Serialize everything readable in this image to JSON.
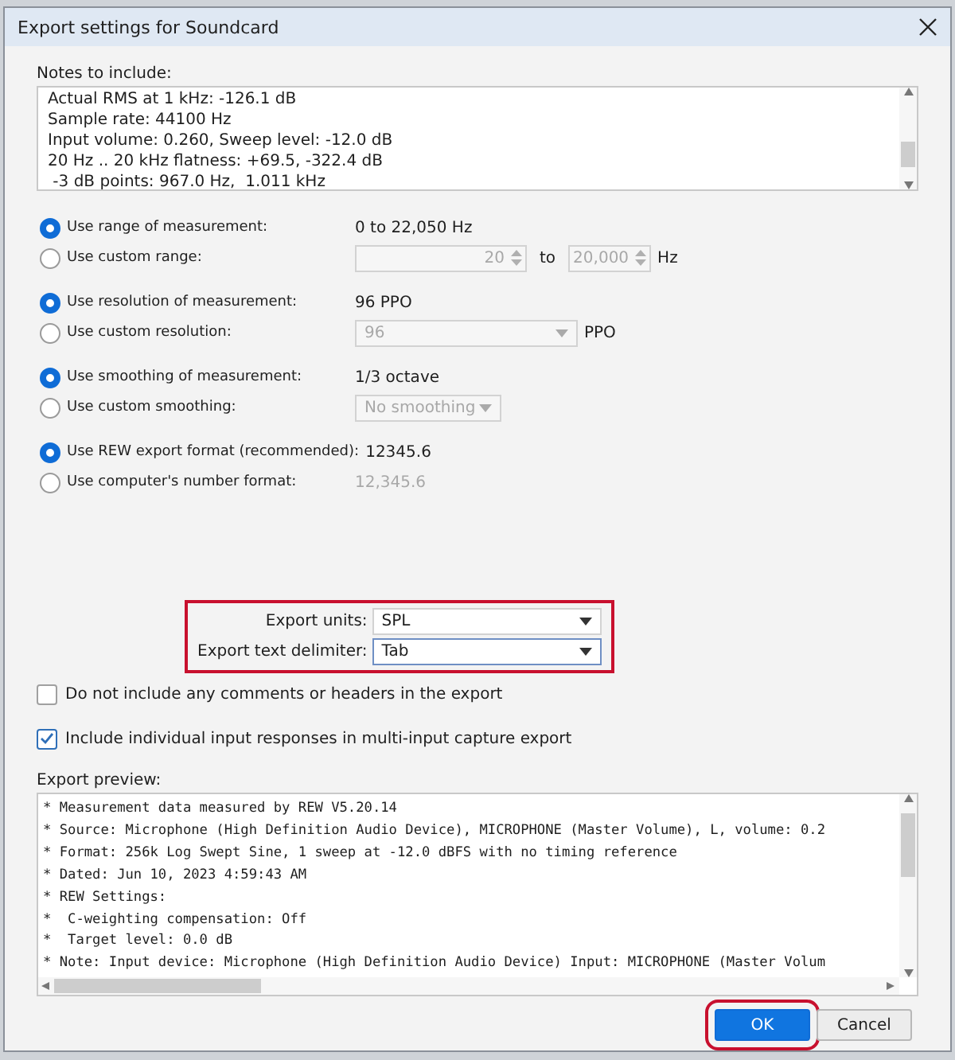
{
  "window": {
    "title": "Export settings for Soundcard"
  },
  "notes": {
    "label": "Notes to include:",
    "lines": [
      "Actual RMS at 1 kHz: -126.1 dB",
      "Sample rate: 44100 Hz",
      "Input volume: 0.260, Sweep level: -12.0 dB",
      "20 Hz .. 20 kHz flatness: +69.5, -322.4 dB",
      " -3 dB points: 967.0 Hz,  1.011 kHz"
    ]
  },
  "option_groups": [
    {
      "options": [
        {
          "label": "Use range of measurement:",
          "selected": true,
          "kind": "text",
          "value": "0 to 22,050 Hz"
        },
        {
          "label": "Use custom range:",
          "selected": false,
          "kind": "range",
          "from": "20",
          "to_label": "to",
          "to": "20,000",
          "unit": "Hz"
        }
      ]
    },
    {
      "options": [
        {
          "label": "Use resolution of measurement:",
          "selected": true,
          "kind": "text",
          "value": "96 PPO"
        },
        {
          "label": "Use custom resolution:",
          "selected": false,
          "kind": "select",
          "value": "96",
          "unit": "PPO"
        }
      ]
    },
    {
      "options": [
        {
          "label": "Use smoothing of measurement:",
          "selected": true,
          "kind": "text",
          "value": "1/3 octave"
        },
        {
          "label": "Use custom smoothing:",
          "selected": false,
          "kind": "small-select",
          "value": "No smoothing"
        }
      ]
    },
    {
      "options": [
        {
          "label": "Use REW export format (recommended):",
          "selected": true,
          "kind": "text",
          "value": "12345.6"
        },
        {
          "label": "Use computer's number format:",
          "selected": false,
          "kind": "text",
          "value": "12,345.6"
        }
      ]
    }
  ],
  "export_fields": {
    "highlighted": true,
    "fields": [
      {
        "label": "Export units:",
        "value": "SPL",
        "focused": false
      },
      {
        "label": "Export text delimiter:",
        "value": "Tab",
        "focused": true
      }
    ]
  },
  "checkboxes": [
    {
      "label": "Do not include any comments or headers in the export",
      "checked": false
    },
    {
      "label": "Include individual input responses in multi-input capture export",
      "checked": true
    }
  ],
  "preview": {
    "label": "Export preview:",
    "lines": [
      "* Measurement data measured by REW V5.20.14",
      "* Source: Microphone (High Definition Audio Device), MICROPHONE (Master Volume), L, volume: 0.2",
      "* Format: 256k Log Swept Sine, 1 sweep at -12.0 dBFS with no timing reference",
      "* Dated: Jun 10, 2023 4:59:43 AM",
      "* REW Settings:",
      "*  C-weighting compensation: Off",
      "*  Target level: 0.0 dB",
      "* Note: Input device: Microphone (High Definition Audio Device) Input: MICROPHONE (Master Volum"
    ]
  },
  "buttons": [
    {
      "label": "OK",
      "primary": true,
      "highlighted": true
    },
    {
      "label": "Cancel",
      "primary": false,
      "highlighted": false
    }
  ]
}
